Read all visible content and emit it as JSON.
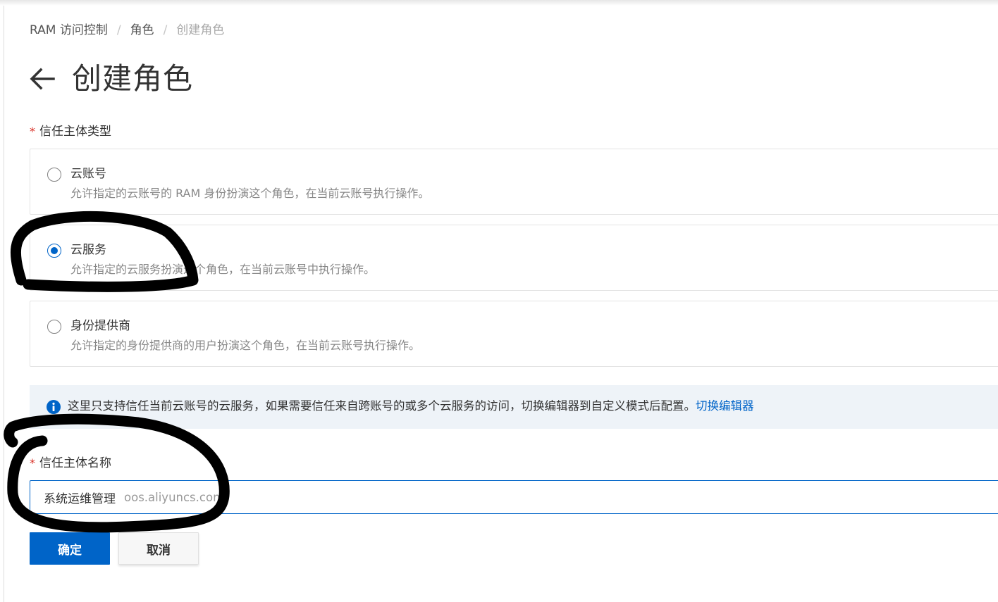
{
  "breadcrumb": {
    "items": [
      "RAM 访问控制",
      "角色",
      "创建角色"
    ],
    "separator": "/"
  },
  "header": {
    "back_icon": "arrow-left-icon",
    "title": "创建角色"
  },
  "trust_type": {
    "label": "信任主体类型",
    "required_mark": "*",
    "options": [
      {
        "title": "云账号",
        "description": "允许指定的云账号的 RAM 身份扮演这个角色，在当前云账号执行操作。",
        "checked": false
      },
      {
        "title": "云服务",
        "description": "允许指定的云服务扮演这个角色，在当前云账号中执行操作。",
        "checked": true
      },
      {
        "title": "身份提供商",
        "description": "允许指定的身份提供商的用户扮演这个角色，在当前云账号执行操作。",
        "checked": false
      }
    ]
  },
  "notice": {
    "icon": "info-icon",
    "text": "这里只支持信任当前云账号的云服务，如果需要信任来自跨账号的或多个云服务的访问，切换编辑器到自定义模式后配置。",
    "link": "切换编辑器"
  },
  "principal": {
    "label": "信任主体名称",
    "required_mark": "*",
    "value": "系统运维管理",
    "domain": "oos.aliyuncs.com"
  },
  "actions": {
    "confirm": "确定",
    "cancel": "取消"
  },
  "colors": {
    "primary": "#0064c8",
    "required": "#d93026",
    "notice_bg": "#eef3f8",
    "annotation_ink": "#000000"
  }
}
